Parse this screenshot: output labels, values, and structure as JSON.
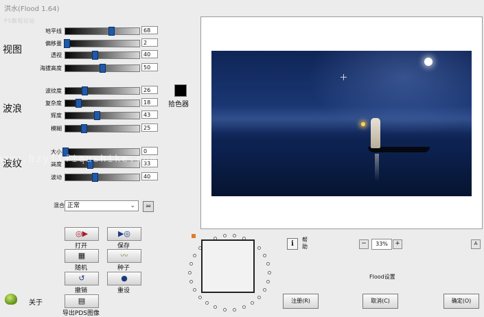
{
  "window": {
    "title": "洪水(Flood 1.64)",
    "watermark_top": "PS教程论坛"
  },
  "sections": {
    "view": "视图",
    "wave": "波浪",
    "ripple": "波纹"
  },
  "view_params": [
    {
      "label": "地平线",
      "value": "68",
      "level": 0.62
    },
    {
      "label": "偏移量",
      "value": "2",
      "level": 0.02
    },
    {
      "label": "透视",
      "value": "40",
      "level": 0.4
    },
    {
      "label": "海拔高度",
      "value": "50",
      "level": 0.5
    }
  ],
  "wave_params": [
    {
      "label": "波纹度",
      "value": "26",
      "level": 0.26
    },
    {
      "label": "复杂度",
      "value": "18",
      "level": 0.18
    },
    {
      "label": "辉度",
      "value": "43",
      "level": 0.43
    },
    {
      "label": "模糊",
      "value": "25",
      "level": 0.25
    }
  ],
  "ripple_params": [
    {
      "label": "大小",
      "value": "0",
      "level": 0.0
    },
    {
      "label": "高度",
      "value": "33",
      "level": 0.33
    },
    {
      "label": "波动",
      "value": "40",
      "level": 0.4
    }
  ],
  "color_picker": {
    "label": "拾色器",
    "color": "#000000"
  },
  "blend": {
    "label": "混合",
    "selected": "正常",
    "side_button": "ae"
  },
  "tools": [
    {
      "label": "打开",
      "icon": "▶"
    },
    {
      "label": "保存",
      "icon": "▶"
    },
    {
      "label": "随机",
      "icon": "▦"
    },
    {
      "label": "种子",
      "icon": "〰"
    },
    {
      "label": "撤销",
      "icon": "↺"
    },
    {
      "label": "重设",
      "icon": "●"
    },
    {
      "label": "导出PDS图像",
      "icon": "▤"
    }
  ],
  "about": {
    "label": "关于"
  },
  "canvas_watermark": "www.hzyjlfiqushike.com",
  "zoom": {
    "minus": "−",
    "value": "33%",
    "plus": "+",
    "corner_btn": "A"
  },
  "help": {
    "icon": "i",
    "label": "帮助"
  },
  "flood_settings": "Flood设置",
  "buttons": {
    "register": "注册(R)",
    "cancel": "取消(C)",
    "ok": "确定(O)"
  },
  "colors": {
    "slider_thumb": "#1e5aa8",
    "scene_sky": "#1c3a78",
    "marker": "#e07b2a"
  }
}
